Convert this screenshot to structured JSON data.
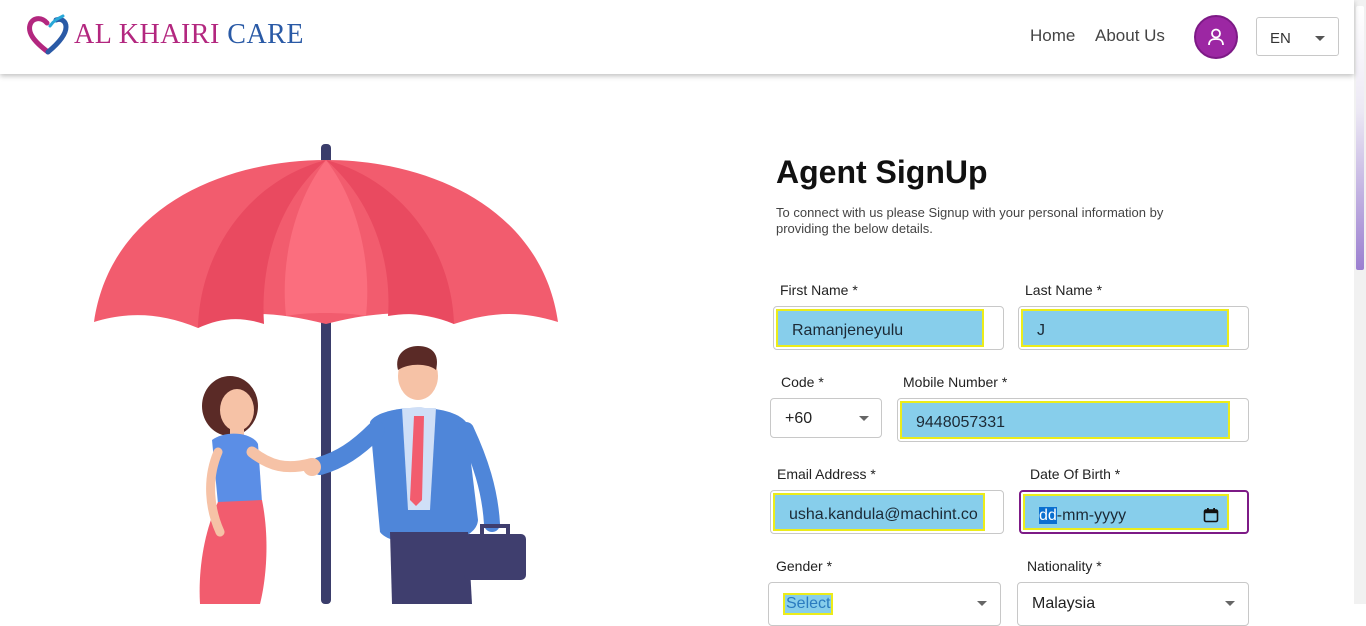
{
  "header": {
    "logo": {
      "part1": "AL KHAIRI ",
      "part2": "CARE",
      "icon": "heart-hands-logo-icon"
    },
    "nav": {
      "home": "Home",
      "about": "About Us"
    },
    "user_icon": "user-icon",
    "language": "EN"
  },
  "main": {
    "illustration": "umbrella-handshake-illustration",
    "title": "Agent SignUp",
    "subtitle": "To connect with us please Signup with your personal information by providing the below details.",
    "form": {
      "first_name": {
        "label": "First Name *",
        "value": "Ramanjeneyulu"
      },
      "last_name": {
        "label": "Last Name *",
        "value": "J"
      },
      "code": {
        "label": "Code *",
        "value": "+60"
      },
      "mobile": {
        "label": "Mobile Number *",
        "value": "9448057331"
      },
      "email": {
        "label": "Email Address *",
        "value": "usha.kandula@machint.co"
      },
      "dob": {
        "label": "Date Of Birth *",
        "day": "dd",
        "rest": "-mm-yyyy"
      },
      "gender": {
        "label": "Gender *",
        "value": "Select"
      },
      "nationality": {
        "label": "Nationality *",
        "value": "Malaysia"
      }
    }
  },
  "colors": {
    "accent": "#9c27a3",
    "field_fill": "#87ceeb",
    "highlight_border": "#ecec1a",
    "umbrella": "#f25c6e"
  }
}
